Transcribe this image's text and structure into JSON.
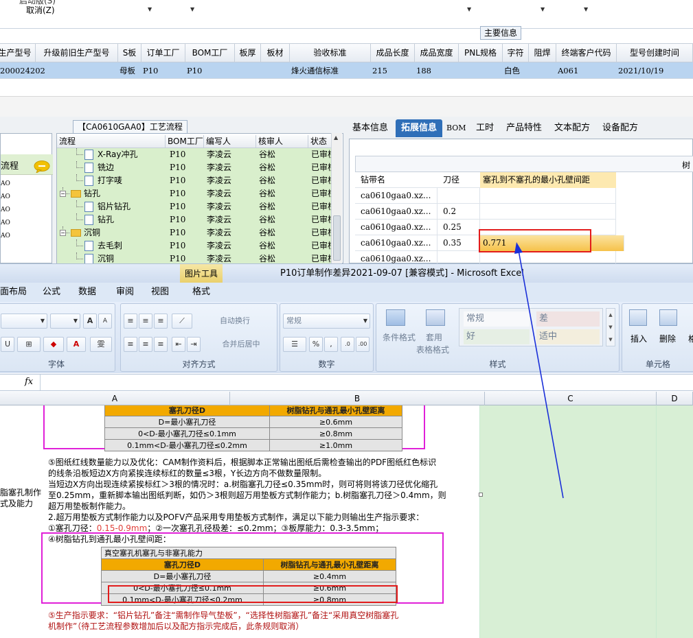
{
  "top": {
    "partial_top_text": "启动版(S)",
    "cancel_label": "取消(Z)",
    "group_label": "主要信息",
    "columns": [
      "生产型号",
      "升级前旧生产型号",
      "S板",
      "订单工厂",
      "BOM工厂",
      "板厚",
      "板材",
      "验收标准",
      "成品长度",
      "成品宽度",
      "PNL规格",
      "字符",
      "阻焊",
      "终端客户代码",
      "型号创建时间"
    ],
    "row": {
      "prod_model": "200024202",
      "s_board": "母板",
      "order_factory": "P10",
      "bom_factory": "P10",
      "standard": "烽火通信标准",
      "length": "215",
      "width": "188",
      "char": "白色",
      "customer": "A061",
      "created": "2021/10/19"
    }
  },
  "left_panel": {
    "title": "流程",
    "items": [
      "AO",
      "AO",
      "AO",
      "AO",
      "AO"
    ]
  },
  "process": {
    "title": "【CA0610GAA0】工艺流程",
    "headers": [
      "流程",
      "BOM工厂",
      "编写人",
      "核审人",
      "状态"
    ],
    "rows": [
      {
        "name": "X-Ray冲孔",
        "type": "file",
        "indent": 2,
        "bom": "P10",
        "writer": "李凌云",
        "checker": "谷松",
        "status": "已审核"
      },
      {
        "name": "铣边",
        "type": "file",
        "indent": 2,
        "bom": "P10",
        "writer": "李凌云",
        "checker": "谷松",
        "status": "已审核"
      },
      {
        "name": "打字唛",
        "type": "file",
        "indent": 2,
        "bom": "P10",
        "writer": "李凌云",
        "checker": "谷松",
        "status": "已审核"
      },
      {
        "name": "钻孔",
        "type": "folder",
        "indent": 1,
        "bom": "P10",
        "writer": "李凌云",
        "checker": "谷松",
        "status": "已审核"
      },
      {
        "name": "铝片钻孔",
        "type": "file",
        "indent": 2,
        "bom": "P10",
        "writer": "李凌云",
        "checker": "谷松",
        "status": "已审核"
      },
      {
        "name": "钻孔",
        "type": "file",
        "indent": 2,
        "bom": "P10",
        "writer": "李凌云",
        "checker": "谷松",
        "status": "已审核"
      },
      {
        "name": "沉铜",
        "type": "folder",
        "indent": 1,
        "bom": "P10",
        "writer": "李凌云",
        "checker": "谷松",
        "status": "已审核"
      },
      {
        "name": "去毛刺",
        "type": "file",
        "indent": 2,
        "bom": "P10",
        "writer": "李凌云",
        "checker": "谷松",
        "status": "已审核"
      },
      {
        "name": "沉铜",
        "type": "file",
        "indent": 2,
        "bom": "P10",
        "writer": "李凌云",
        "checker": "谷松",
        "status": "已审核"
      }
    ]
  },
  "right_tabs": [
    "基本信息",
    "拓展信息",
    "BOM",
    "工时",
    "产品特性",
    "文本配方",
    "设备配方"
  ],
  "right_topbar_text": "树",
  "drill": {
    "headers": [
      "钻带名",
      "刀径",
      "塞孔到不塞孔的最小孔壁间距"
    ],
    "rows": [
      {
        "name": "ca0610gaa0.xz...",
        "dia": "",
        "min": ""
      },
      {
        "name": "ca0610gaa0.xz...",
        "dia": "0.2",
        "min": ""
      },
      {
        "name": "ca0610gaa0.xz...",
        "dia": "0.25",
        "min": ""
      },
      {
        "name": "ca0610gaa0.xz...",
        "dia": "0.35",
        "min": "0.771"
      },
      {
        "name": "ca0610gaa0.xz...",
        "dia": "",
        "min": ""
      }
    ]
  },
  "excel": {
    "pic_tools": "图片工具",
    "title": "P10订单制作差异2021-09-07 [兼容模式] - Microsoft Excel",
    "tabs": [
      "面布局",
      "公式",
      "数据",
      "审阅",
      "视图",
      "格式"
    ],
    "groups": {
      "font": "字体",
      "align": "对齐方式",
      "number": "数字",
      "styles": "样式",
      "cells": "单元格"
    },
    "wrap_text": "自动换行",
    "merge_center": "合并后居中",
    "number_format": "常规",
    "cond_format": "条件格式",
    "table_format_1": "套用",
    "table_format_2": "表格格式",
    "style_normal": "常规",
    "style_bad": "差",
    "style_good": "好",
    "style_neutral": "适中",
    "insert": "插入",
    "delete": "删除",
    "format_partial": "格",
    "fx": "fx",
    "columns": [
      "A",
      "B",
      "C",
      "D"
    ]
  },
  "sheet": {
    "left_label_1": "脂塞孔制作",
    "left_label_2": "式及能力",
    "table1": {
      "h1": "塞孔刀径D",
      "h2": "树脂钻孔与通孔最小孔壁距离",
      "rows": [
        [
          "D=最小塞孔刀径",
          "≥0.6mm"
        ],
        [
          "0<D-最小塞孔刀径≤0.1mm",
          "≥0.8mm"
        ],
        [
          "0.1mm<D-最小塞孔刀径≤0.2mm",
          "≥1.0mm"
        ]
      ]
    },
    "para": [
      "⑤图纸红线数量能力以及优化：CAM制作资料后，根据脚本正常输出图纸后需检查输出的PDF图纸红色标识",
      "的线条沿板短边X方向紧挨连续标红的数量≤3根，Y长边方向不做数量限制。",
      "当短边X方向出现连续紧挨标红＞3根的情况时：a.树脂塞孔刀径≤0.35mm时，则可将则将该刀径优化缩孔",
      "至0.25mm，重新脚本输出图纸判断，如仍＞3根则超万用垫板方式制作能力；b.树脂塞孔刀径＞0.4mm，则",
      "超万用垫板制作能力。",
      "2.超万用垫板方式制作能力以及POFV产品采用专用垫板方式制作，满足以下能力则输出生产指示要求："
    ],
    "cap_prefix1": "①塞孔刀径：",
    "cap_val1": "0.15-0.9mm",
    "cap_mid": "；②一次塞孔孔径极差：≤0.2mm；③板厚能力：0.3-3.5mm；",
    "sec4_title": "④树脂钻孔到通孔最小孔壁间距：",
    "table2": {
      "caption": "真空塞孔机塞孔与非塞孔能力",
      "h1": "塞孔刀径D",
      "h2": "树脂钻孔与通孔最小孔壁距离",
      "rows": [
        [
          "D=最小塞孔刀径",
          "≥0.4mm"
        ],
        [
          "0<D-最小塞孔刀径≤0.1mm",
          "≥0.6mm"
        ],
        [
          "0.1mm<D-最小塞孔刀径≤0.2mm",
          "≥0.8mm"
        ]
      ]
    },
    "req_line1": "⑤生产指示要求：“铝片钻孔”备注“需制作导气垫板”，“选择性树脂塞孔”备注“采用真空树脂塞孔",
    "req_line2": "机制作”（待工艺流程参数增加后以及配方指示完成后，此条规则取消）"
  }
}
